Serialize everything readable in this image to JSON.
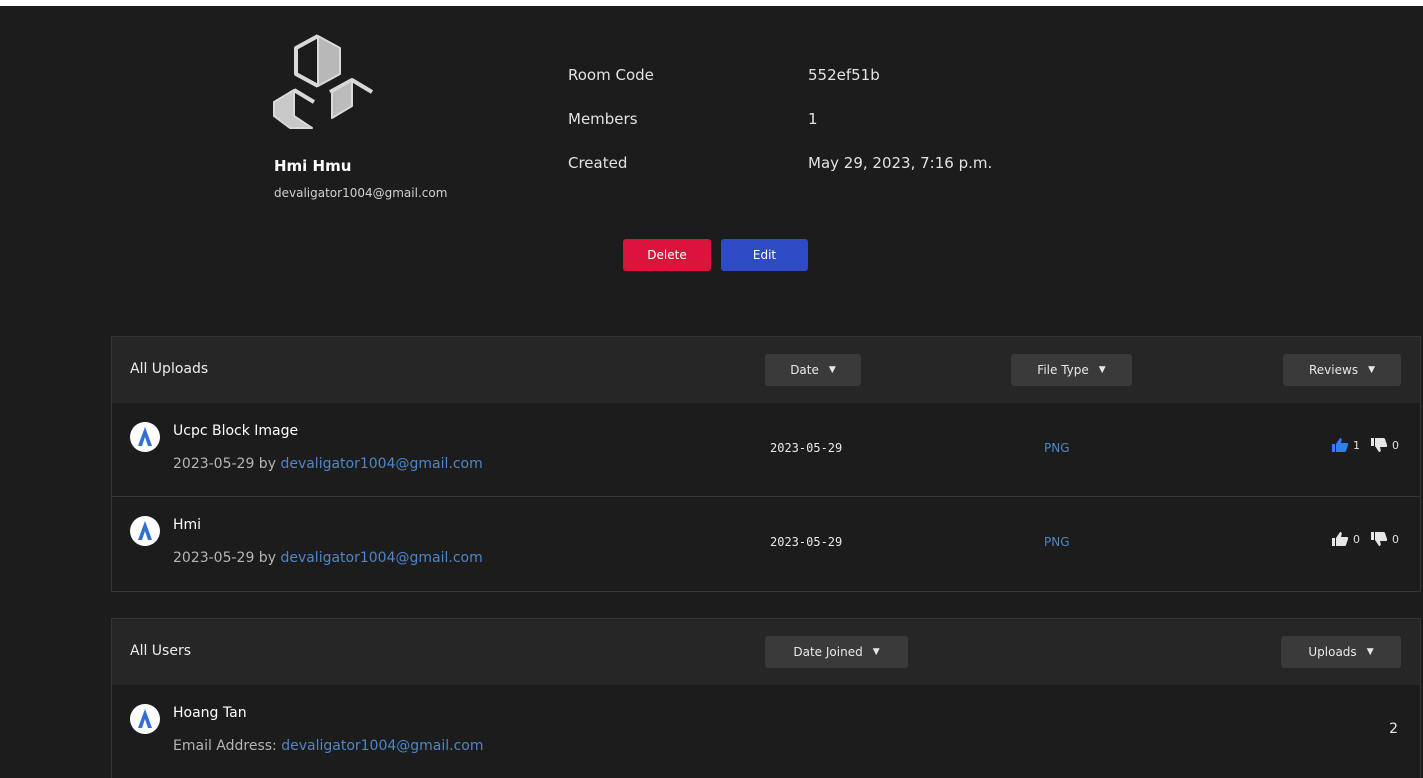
{
  "profile": {
    "name": "Hmi Hmu",
    "email": "devaligator1004@gmail.com"
  },
  "room": {
    "code_label": "Room Code",
    "code_value": "552ef51b",
    "members_label": "Members",
    "members_value": "1",
    "created_label": "Created",
    "created_value": "May 29, 2023, 7:16 p.m."
  },
  "actions": {
    "delete_label": "Delete",
    "edit_label": "Edit"
  },
  "uploads": {
    "title": "All Uploads",
    "sort_date": "Date",
    "sort_file_type": "File Type",
    "sort_reviews": "Reviews",
    "caret": "▼",
    "items": [
      {
        "title": "Ucpc Block Image",
        "date_prefix": "2023-05-29 by",
        "author": "devaligator1004@gmail.com",
        "date": "2023-05-29",
        "file_type": "PNG",
        "likes": "1",
        "dislikes": "0",
        "liked": true
      },
      {
        "title": "Hmi",
        "date_prefix": "2023-05-29 by",
        "author": "devaligator1004@gmail.com",
        "date": "2023-05-29",
        "file_type": "PNG",
        "likes": "0",
        "dislikes": "0",
        "liked": false
      }
    ]
  },
  "users": {
    "title": "All Users",
    "sort_date_joined": "Date Joined",
    "sort_uploads": "Uploads",
    "items": [
      {
        "name": "Hoang Tan",
        "email_prefix": "Email Address:",
        "email": "devaligator1004@gmail.com",
        "uploads": "2"
      }
    ]
  },
  "colors": {
    "background": "#1c1c1c",
    "panel_header": "#262626",
    "delete": "#dc143c",
    "edit": "#2e4ac4",
    "link": "#4f86c6",
    "like_active": "#2f7ff0"
  }
}
